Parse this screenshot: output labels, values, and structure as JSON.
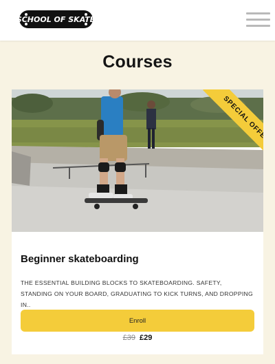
{
  "header": {
    "logo_text": "SCHOOL OF SKATE",
    "menu_icon": "hamburger-icon"
  },
  "page": {
    "title": "Courses"
  },
  "course": {
    "badge": "SPECIAL OFFER",
    "title": "Beginner skateboarding",
    "description": "THE ESSENTIAL BUILDING BLOCKS TO SKATEBOARDING. SAFETY, STANDING ON YOUR BOARD, GRADUATING TO KICK TURNS, AND DROPPING IN..",
    "enroll_label": "Enroll",
    "old_price": "£39",
    "new_price": "£29"
  },
  "colors": {
    "page_bg": "#f8f3e3",
    "accent_yellow": "#f4cc3a",
    "card_bg": "#ffffff"
  }
}
